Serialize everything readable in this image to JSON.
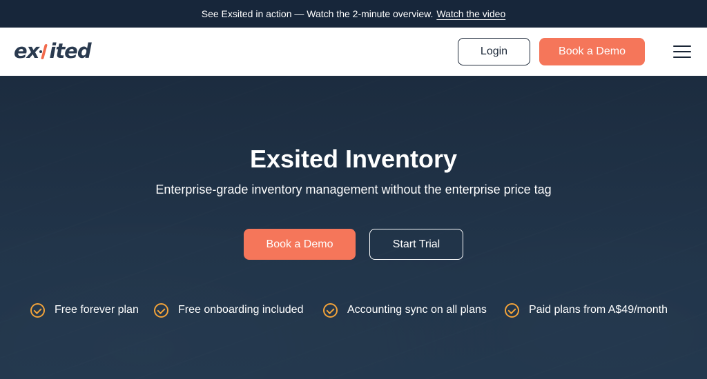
{
  "announcement": {
    "text": "See Exsited in action — Watch the 2-minute overview.",
    "link": "Watch the video"
  },
  "header": {
    "logo_prefix": "ex",
    "logo_suffix": "ited",
    "login": "Login",
    "book_demo": "Book a Demo"
  },
  "hero": {
    "title": "Exsited Inventory",
    "subtitle": "Enterprise-grade inventory management without the enterprise price tag",
    "book_demo": "Book a Demo",
    "start_trial": "Start Trial",
    "features": [
      "Free forever plan",
      "Free onboarding included",
      "Accounting sync on all plans",
      "Paid plans from A$49/month"
    ]
  },
  "colors": {
    "accent": "#f5765a",
    "check": "#f2a33a",
    "navy": "#1a2636"
  }
}
